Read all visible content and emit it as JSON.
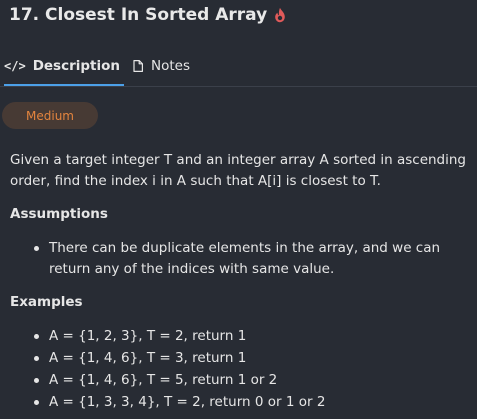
{
  "header": {
    "title": "17. Closest In Sorted Array",
    "flame_color": "#e05a5a"
  },
  "tabs": [
    {
      "label": "Description",
      "icon": "code-icon",
      "active": true
    },
    {
      "label": "Notes",
      "icon": "document-icon",
      "active": false
    }
  ],
  "difficulty": {
    "label": "Medium",
    "color": "#e3843e"
  },
  "description": "Given a target integer T and an integer array A sorted in ascending order, find the index i in A such that A[i] is closest to T.",
  "assumptions": {
    "title": "Assumptions",
    "items": [
      "There can be duplicate elements in the array, and we can return any of the indices with same value."
    ]
  },
  "examples": {
    "title": "Examples",
    "items": [
      "A = {1, 2, 3}, T = 2, return 1",
      "A = {1, 4, 6}, T = 3, return 1",
      "A = {1, 4, 6}, T = 5, return 1 or 2",
      "A = {1, 3, 3, 4}, T = 2, return 0 or 1 or 2"
    ]
  }
}
